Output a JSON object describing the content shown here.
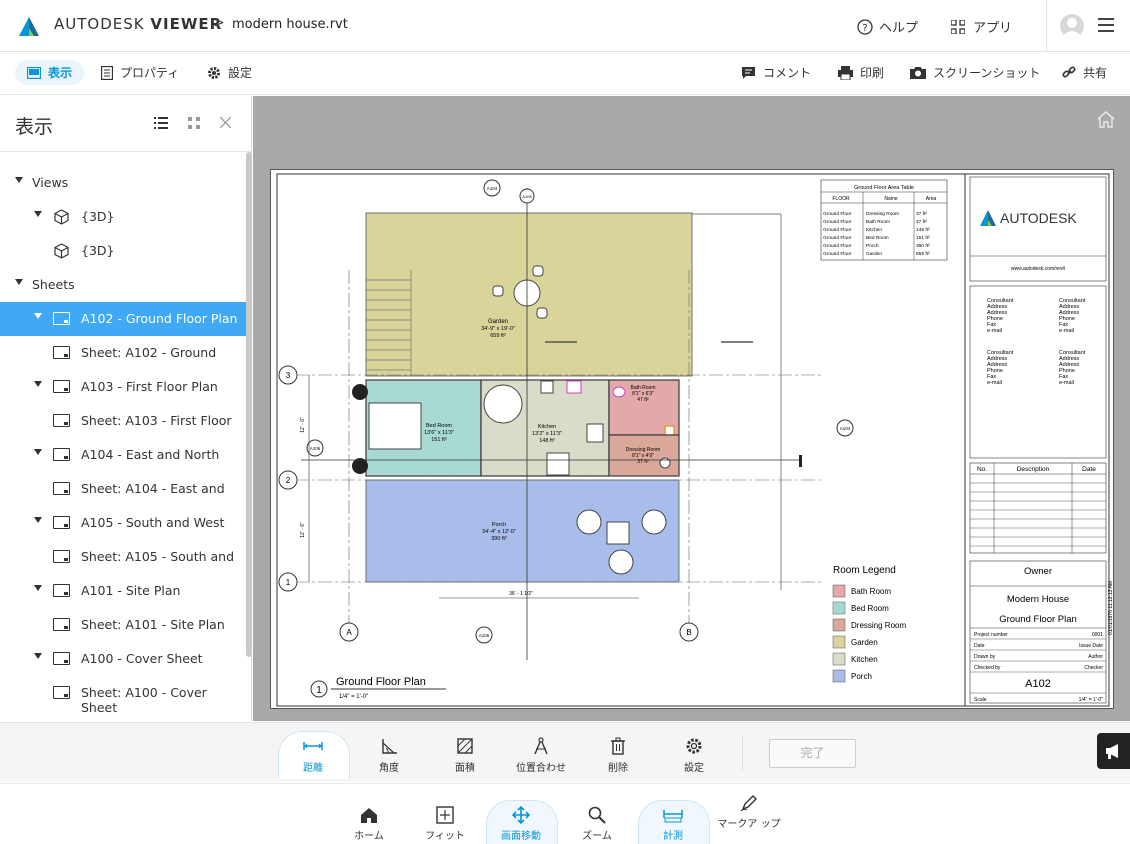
{
  "app": {
    "brand_light": "AUTODESK",
    "brand_bold": "VIEWER",
    "breadcrumb_sep": ">",
    "filename": "modern house.rvt",
    "help": "ヘルプ",
    "apps": "アプリ"
  },
  "toolbar": {
    "view": "表示",
    "properties": "プロパティ",
    "settings": "設定",
    "comment": "コメント",
    "print": "印刷",
    "screenshot": "スクリーンショット",
    "share": "共有"
  },
  "panel": {
    "title": "表示",
    "views_label": "Views",
    "views": [
      "{3D}",
      "{3D}"
    ],
    "sheets_label": "Sheets",
    "sheets": [
      {
        "label": "A102 - Ground Floor Plan",
        "child": "Sheet: A102 - Ground"
      },
      {
        "label": "A103 - First Floor Plan",
        "child": "Sheet: A103 - First Floor"
      },
      {
        "label": "A104 - East and North",
        "child": "Sheet: A104 - East and"
      },
      {
        "label": "A105 - South and West",
        "child": "Sheet: A105 - South and"
      },
      {
        "label": "A101 - Site Plan",
        "child": "Sheet: A101 - Site Plan"
      },
      {
        "label": "A100 - Cover Sheet",
        "child": "Sheet: A100 - Cover Sheet"
      }
    ]
  },
  "drawing": {
    "area_table_title": "Ground Floor Area Table",
    "area_table_headers": [
      "FLOOR",
      "Name",
      "Area"
    ],
    "area_table_rows": [
      [
        "Ground Floor",
        "Dressing Room",
        "37 ft²"
      ],
      [
        "Ground Floor",
        "Bath Room",
        "47 ft²"
      ],
      [
        "Ground Floor",
        "Kitchen",
        "148 ft²"
      ],
      [
        "Ground Floor",
        "Bed Room",
        "151 ft²"
      ],
      [
        "Ground Floor",
        "Porch",
        "390 ft²"
      ],
      [
        "Ground Floor",
        "Garden",
        "659 ft²"
      ]
    ],
    "autodesk_logo_text": "AUTODESK",
    "autodesk_url": "www.autodesk.com/revit",
    "consultant_block": [
      "Consultant",
      "Address",
      "Address",
      "Phone",
      "Fax",
      "e-mail"
    ],
    "rev_headers": [
      "No.",
      "Description",
      "Date"
    ],
    "owner": "Owner",
    "project": "Modern House",
    "sheet_title": "Ground  Floor Plan",
    "info_rows": [
      [
        "Project number",
        "0001"
      ],
      [
        "Date",
        "Issue Date"
      ],
      [
        "Drawn by",
        "Author"
      ],
      [
        "Checked by",
        "Checker"
      ]
    ],
    "sheet_number": "A102",
    "scale_label": "Scale",
    "scale_value": "1/4\" = 1'-0\"",
    "timestamp": "01/01/1970 11:12:13 AM",
    "legend_title": "Room Legend",
    "legend": [
      {
        "name": "Bath Room",
        "color": "#e3a8a8"
      },
      {
        "name": "Bed Room",
        "color": "#a8d9d2"
      },
      {
        "name": "Dressing Room",
        "color": "#d9a89a"
      },
      {
        "name": "Garden",
        "color": "#d9d49a"
      },
      {
        "name": "Kitchen",
        "color": "#d9dcc9"
      },
      {
        "name": "Porch",
        "color": "#a9bdea"
      }
    ],
    "rooms": {
      "garden": [
        "Garden",
        "34'-9\" x 19'-0\"",
        "659 ft²"
      ],
      "bed": [
        "Bed Room",
        "13'6\" x 11'3\"",
        "151 ft²"
      ],
      "kitchen": [
        "Kitchen",
        "13'2\" x 11'3\"",
        "148 ft²"
      ],
      "bath": [
        "Bath Room",
        "8'1\" x 6'3\"",
        "47 ft²"
      ],
      "dressing": [
        "Dressing Room",
        "8'1\" x 4'9\"",
        "37 ft²"
      ],
      "porch": [
        "Porch",
        "34'-4\" x 12'-0\"",
        "390 ft²"
      ]
    },
    "grid": [
      "3",
      "2",
      "1",
      "A",
      "B"
    ],
    "tags": [
      "A104",
      "A105",
      "A106",
      "A104",
      "A105"
    ],
    "dimension": "36' - 1 1/2\"",
    "dim_left_top": "12' - 6\"",
    "dim_left_bottom": "12' - 6\"",
    "plan_title": "Ground Floor Plan",
    "plan_number": "1",
    "plan_scale": "1/4\" = 1'-0\""
  },
  "measure": {
    "distance": "距離",
    "angle": "角度",
    "area": "面積",
    "align": "位置合わせ",
    "delete": "削除",
    "settings": "設定",
    "done": "完了"
  },
  "bottom": {
    "home": "ホーム",
    "fit": "フィット",
    "pan": "画面移動",
    "zoom": "ズーム",
    "measure": "計測",
    "markup": "マークア ップ"
  },
  "colors": {
    "accent": "#0696d7",
    "selected_row": "#3fa9f5"
  }
}
